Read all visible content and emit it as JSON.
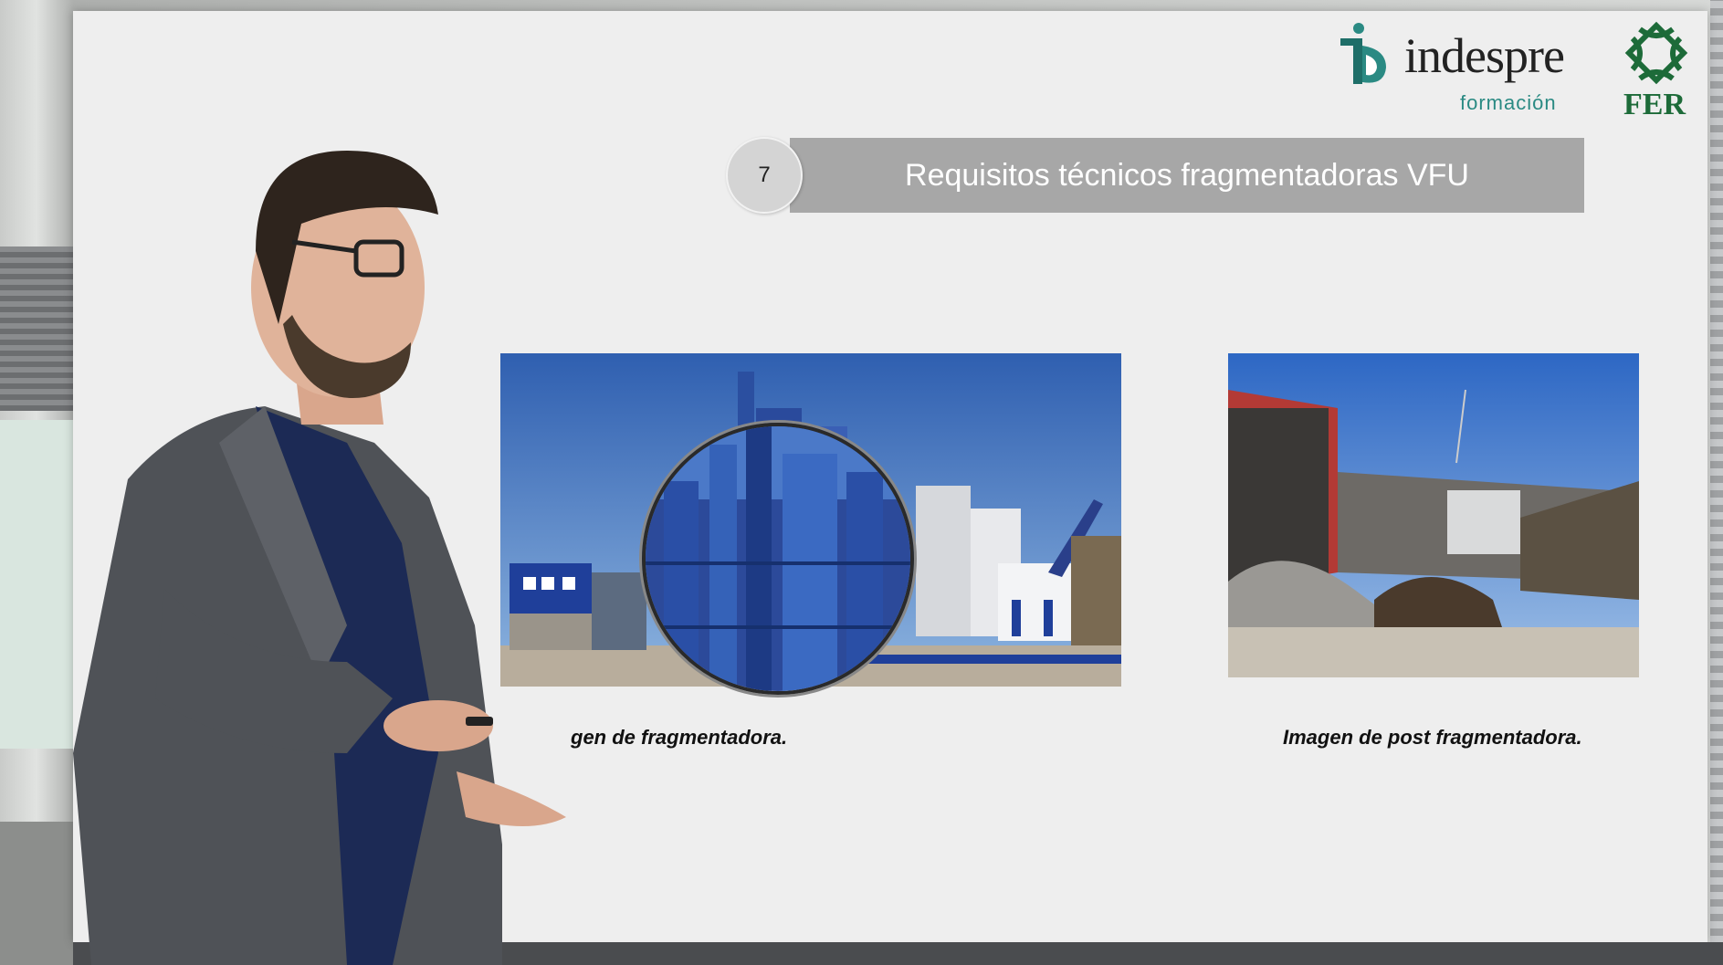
{
  "slide": {
    "number": "7",
    "title": "Requisitos técnicos fragmentadoras VFU"
  },
  "logos": {
    "indespre_word": "indespre",
    "indespre_sub": "formación",
    "fer_text": "FER"
  },
  "images": [
    {
      "caption_visible": "gen de fragmentadora."
    },
    {
      "caption": "Imagen de post fragmentadora."
    }
  ],
  "colors": {
    "title_bar": "#a7a7a7",
    "brand_teal": "#2a8a83",
    "fer_green": "#1d6b39",
    "slide_bg": "#eeeeee"
  }
}
